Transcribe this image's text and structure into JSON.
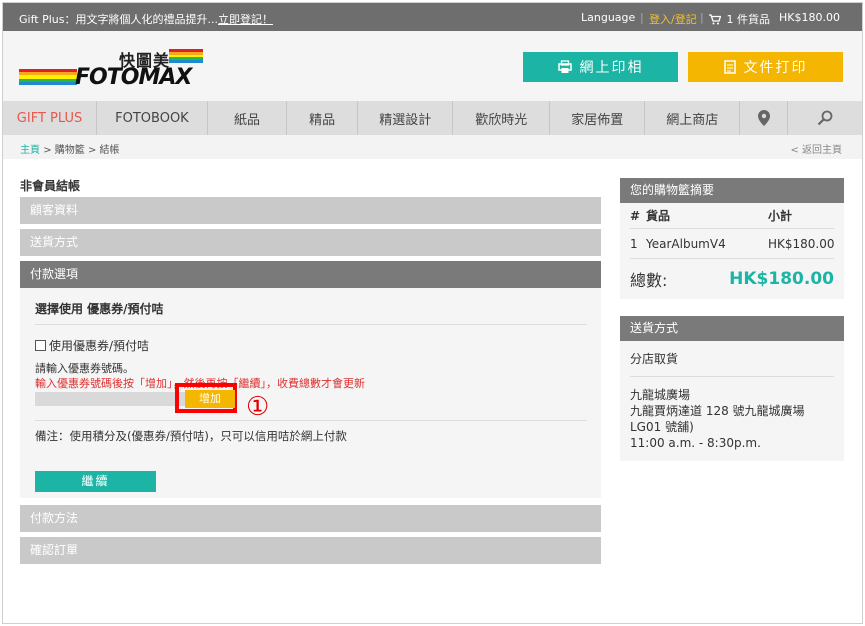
{
  "topbar": {
    "promo_text": "Gift Plus：用文字將個人化的禮品提升...",
    "promo_link": "立即登記！",
    "language": "Language",
    "login": "登入/登記",
    "cart_count": "1 件貨品",
    "cart_total": "HK$180.00"
  },
  "header": {
    "logo_cn": "快圖美",
    "logo_en": "FOTOMAX",
    "photo_button": "網上印相",
    "doc_button": "文件打印"
  },
  "nav": {
    "items": [
      "GIFT PLUS",
      "FOTOBOOK",
      "紙品",
      "精品",
      "精選設計",
      "歡欣時光",
      "家居佈置",
      "網上商店"
    ]
  },
  "breadcrumb": {
    "home": "主頁",
    "cart": "購物籃",
    "checkout": "結帳",
    "separator": ">",
    "back": "< 返回主頁"
  },
  "checkout": {
    "title": "非會員結帳",
    "sections": {
      "customer": "顧客資料",
      "delivery": "送貨方式",
      "payment_options": "付款選項",
      "payment_method": "付款方法",
      "confirm": "確認訂單"
    },
    "coupon": {
      "heading": "選擇使用 優惠券/預付咭",
      "checkbox_label": "使用優惠券/預付咭",
      "prompt": "請輸入優惠券號碼。",
      "instruction": "輸入優惠券號碼後按「增加」，然後再按「繼續」，收費總數才會更新",
      "add_button": "增加",
      "annotation": "①",
      "note": "備注：使用積分及(優惠券/預付咭)，只可以信用咭於網上付款",
      "continue_button": "繼續"
    }
  },
  "summary": {
    "title": "您的購物籃摘要",
    "columns": [
      "#",
      "貨品",
      "小計"
    ],
    "items": [
      {
        "index": "1",
        "name": "YearAlbumV4",
        "subtotal": "HK$180.00"
      }
    ],
    "total_label": "總數:",
    "total_value": "HK$180.00"
  },
  "shipping": {
    "title": "送貨方式",
    "method": "分店取貨",
    "store_name": "九龍城廣場",
    "address": "九龍賈炳達道 128 號九龍城廣場 LG01 號舖)",
    "hours": "11:00 a.m. - 8:30p.m."
  },
  "colors": {
    "teal": "#1cb4a4",
    "yellow": "#f4b600",
    "red_highlight": "#ff0000",
    "nav_active": "#e8574e"
  }
}
